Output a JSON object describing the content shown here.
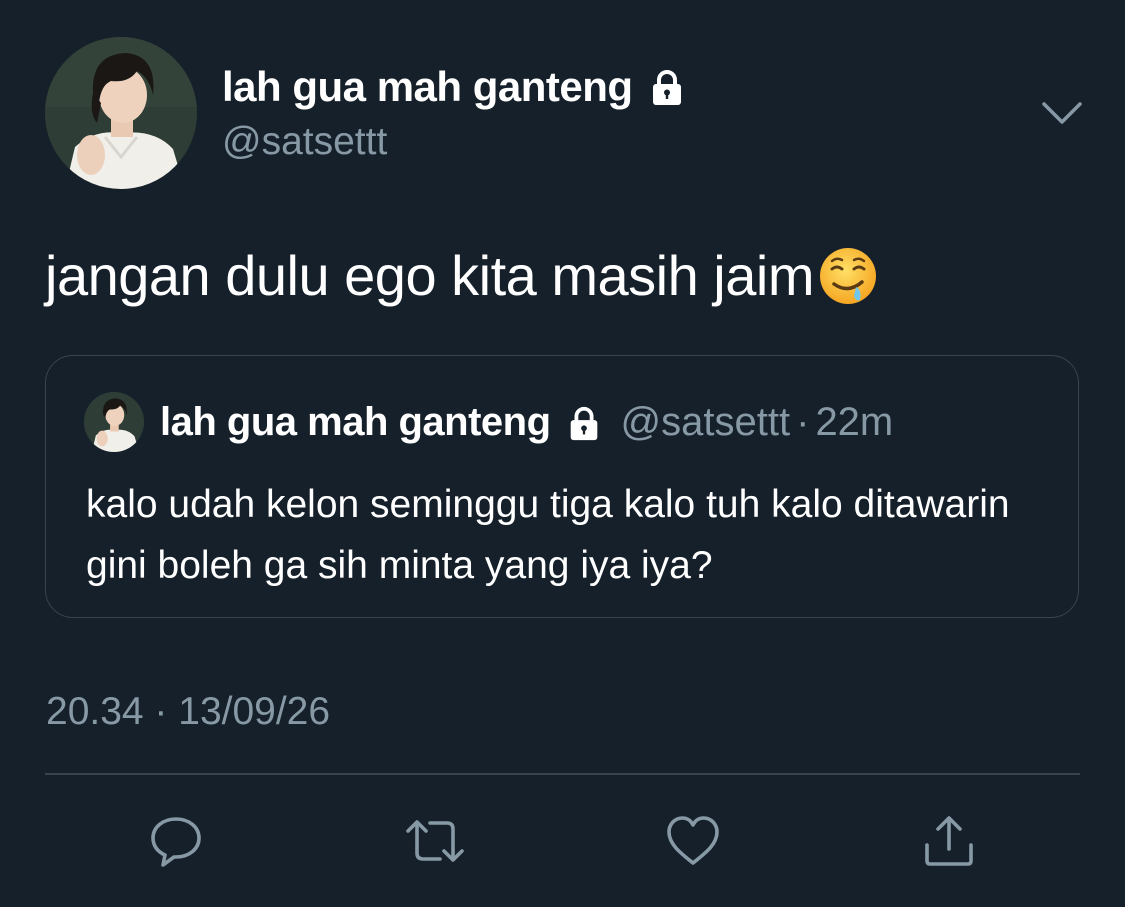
{
  "tweet": {
    "author": {
      "display_name": "lah gua mah ganteng",
      "handle": "@satsettt",
      "protected_icon": "lock-icon"
    },
    "text": "jangan dulu ego kita masih jaim",
    "emoji": "drooling-face",
    "timestamp": "20.34 · 13/09/26"
  },
  "quoted_tweet": {
    "author": {
      "display_name": "lah gua mah ganteng",
      "handle": "@satsettt",
      "protected_icon": "lock-icon"
    },
    "separator": "·",
    "relative_time": "22m",
    "text": "kalo udah kelon seminggu tiga kalo tuh kalo ditawarin gini boleh ga sih minta yang iya iya?"
  },
  "actions": [
    {
      "icon": "reply-icon"
    },
    {
      "icon": "retweet-icon"
    },
    {
      "icon": "like-icon"
    },
    {
      "icon": "share-icon"
    }
  ],
  "colors": {
    "background": "#15202b",
    "text_primary": "#ffffff",
    "text_secondary": "#8899a6",
    "border": "#38444d"
  }
}
